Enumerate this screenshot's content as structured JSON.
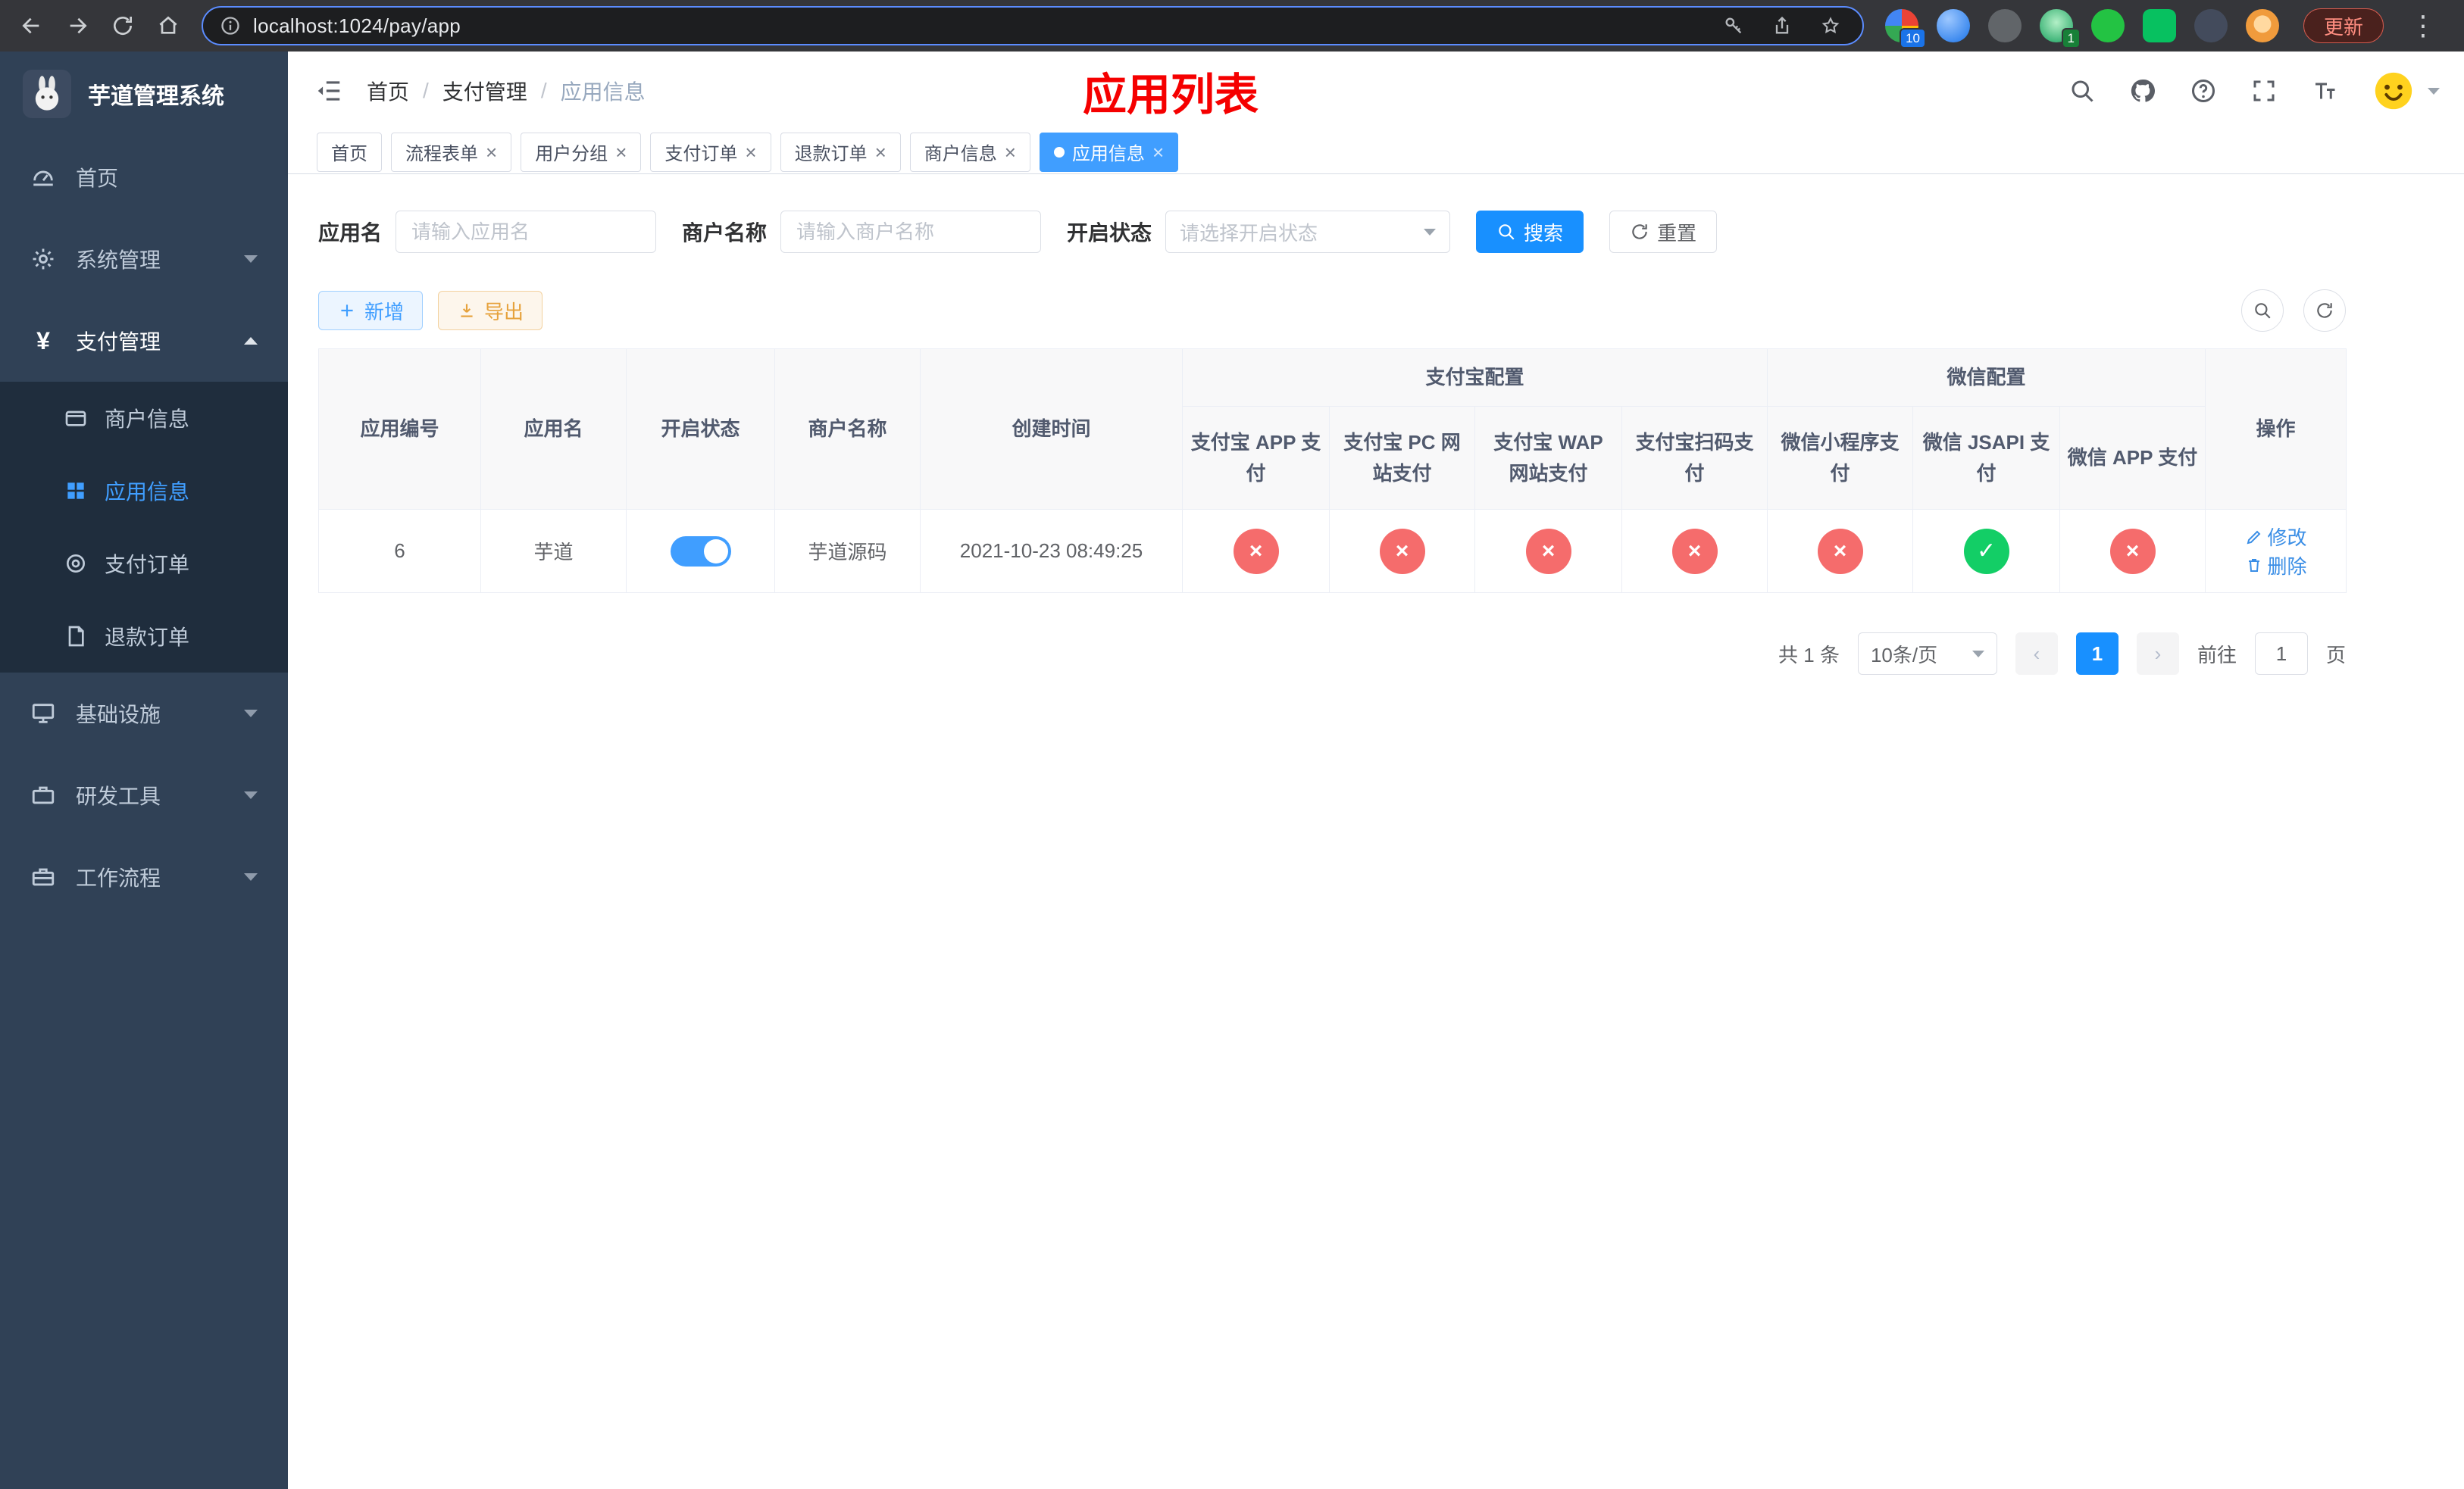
{
  "browser": {
    "url": "localhost:1024/pay/app",
    "update_label": "更新",
    "ext_badge_1": "10",
    "ext_badge_2": "1"
  },
  "sidebar": {
    "logo_title": "芋道管理系统",
    "items": [
      {
        "label": "首页"
      },
      {
        "label": "系统管理"
      },
      {
        "label": "支付管理",
        "children": [
          {
            "label": "商户信息"
          },
          {
            "label": "应用信息",
            "active": true
          },
          {
            "label": "支付订单"
          },
          {
            "label": "退款订单"
          }
        ]
      },
      {
        "label": "基础设施"
      },
      {
        "label": "研发工具"
      },
      {
        "label": "工作流程"
      }
    ]
  },
  "header": {
    "breadcrumb": [
      "首页",
      "支付管理",
      "应用信息"
    ],
    "overlay_title": "应用列表"
  },
  "tabs": [
    {
      "label": "首页",
      "closable": false,
      "active": false
    },
    {
      "label": "流程表单",
      "closable": true,
      "active": false
    },
    {
      "label": "用户分组",
      "closable": true,
      "active": false
    },
    {
      "label": "支付订单",
      "closable": true,
      "active": false
    },
    {
      "label": "退款订单",
      "closable": true,
      "active": false
    },
    {
      "label": "商户信息",
      "closable": true,
      "active": false
    },
    {
      "label": "应用信息",
      "closable": true,
      "active": true
    }
  ],
  "filters": {
    "app_name_label": "应用名",
    "app_name_placeholder": "请输入应用名",
    "merchant_label": "商户名称",
    "merchant_placeholder": "请输入商户名称",
    "status_label": "开启状态",
    "status_placeholder": "请选择开启状态",
    "search_label": "搜索",
    "reset_label": "重置"
  },
  "toolbar": {
    "add_label": "新增",
    "export_label": "导出"
  },
  "table": {
    "headers": {
      "id": "应用编号",
      "name": "应用名",
      "status": "开启状态",
      "merchant": "商户名称",
      "created": "创建时间",
      "alipay_group": "支付宝配置",
      "wechat_group": "微信配置",
      "alipay_app": "支付宝 APP 支付",
      "alipay_pc": "支付宝 PC 网站支付",
      "alipay_wap": "支付宝 WAP 网站支付",
      "alipay_qr": "支付宝扫码支付",
      "wx_mini": "微信小程序支付",
      "wx_jsapi": "微信 JSAPI 支付",
      "wx_app": "微信 APP 支付",
      "actions": "操作"
    },
    "row": {
      "id": "6",
      "name": "芋道",
      "enabled": true,
      "merchant": "芋道源码",
      "created": "2021-10-23 08:49:25",
      "config": {
        "alipay_app": false,
        "alipay_pc": false,
        "alipay_wap": false,
        "alipay_qr": false,
        "wx_mini": false,
        "wx_jsapi": true,
        "wx_app": false
      },
      "edit_label": "修改",
      "delete_label": "删除"
    }
  },
  "pagination": {
    "total": "共 1 条",
    "page_size": "10条/页",
    "page": "1",
    "goto_label": "前往",
    "goto_value": "1",
    "unit": "页"
  },
  "colors": {
    "primary": "#409eff",
    "search_blue": "#1890ff",
    "danger_red": "#f56c6c",
    "success_green": "#13ce66",
    "warning_orange": "#e6a23c",
    "sidebar_bg": "#304156",
    "submenu_bg": "#1f2d3d",
    "annotation_red": "#f50000"
  }
}
